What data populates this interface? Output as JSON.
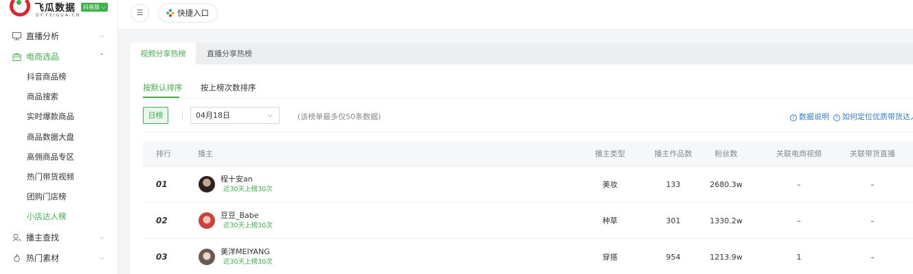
{
  "logo": {
    "name": "飞瓜数据",
    "badge": "抖音版",
    "domain": "DY.FEIGUA.CN"
  },
  "sidebar": {
    "items": [
      {
        "label": "直播分析",
        "icon": "monitor-icon",
        "expanded": false
      },
      {
        "label": "电商选品",
        "icon": "shopping-bag-icon",
        "expanded": true
      },
      {
        "label": "播主查找",
        "icon": "user-search-icon",
        "expanded": false
      },
      {
        "label": "热门素材",
        "icon": "flame-icon",
        "expanded": false
      }
    ],
    "subitems": [
      "抖音商品榜",
      "商品搜索",
      "实时爆款商品",
      "商品数据大盘",
      "高佣商品专区",
      "热门带货视频",
      "团购门店榜",
      "小店达人榜"
    ],
    "active_subitem": "小店达人榜"
  },
  "topbar": {
    "menu_toggle": "☰",
    "quick_entry": "快捷入口"
  },
  "main_tabs": [
    "视频分享热榜",
    "直播分享热榜"
  ],
  "sub_tabs": [
    "按默认排序",
    "按上榜次数排序"
  ],
  "filter": {
    "period_button": "日榜",
    "date_value": "04月18日",
    "hint": "(该榜单最多仅50条数据)",
    "help_links": [
      "数据说明",
      "如何定位优质带货达人"
    ]
  },
  "table": {
    "columns": [
      "排行",
      "播主",
      "播主类型",
      "播主作品数",
      "粉丝数",
      "关联电商视频",
      "关联带货直播"
    ],
    "rows": [
      {
        "rank": "01",
        "name": "程十安an",
        "sub": "近30天上榜30次",
        "type": "美妆",
        "works": "133",
        "fans": "2680.3w",
        "videos": "–",
        "lives": "–"
      },
      {
        "rank": "02",
        "name": "豆豆_Babe",
        "sub": "近30天上榜30次",
        "type": "种草",
        "works": "301",
        "fans": "1330.2w",
        "videos": "–",
        "lives": "–"
      },
      {
        "rank": "03",
        "name": "美洋MEIYANG",
        "sub": "近30天上榜30次",
        "type": "穿搭",
        "works": "954",
        "fans": "1213.9w",
        "videos": "1",
        "lives": "–"
      }
    ]
  },
  "colors": {
    "accent": "#3db04b",
    "brand_red": "#e2232a",
    "link": "#2f7fd1"
  }
}
